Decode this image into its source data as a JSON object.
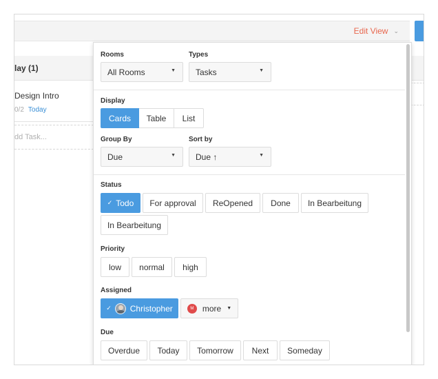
{
  "header": {
    "edit_view_label": "Edit View",
    "edit_view_icon": "chevron-down-icon"
  },
  "background_list": {
    "group_title": "lay (1)",
    "task": {
      "title": "Design Intro",
      "subtasks": "0/2",
      "due": "Today"
    },
    "add_task_placeholder": "dd Task..."
  },
  "filters": {
    "rooms": {
      "label": "Rooms",
      "value": "All Rooms"
    },
    "types": {
      "label": "Types",
      "value": "Tasks"
    },
    "display": {
      "label": "Display",
      "options": [
        "Cards",
        "Table",
        "List"
      ],
      "active": "Cards"
    },
    "group_by": {
      "label": "Group By",
      "value": "Due"
    },
    "sort_by": {
      "label": "Sort by",
      "value": "Due ↑"
    },
    "status": {
      "label": "Status",
      "options": [
        "Todo",
        "For approval",
        "ReOpened",
        "Done",
        "In Bearbeitung",
        "In Bearbeitung"
      ],
      "active": "Todo"
    },
    "priority": {
      "label": "Priority",
      "options": [
        "low",
        "normal",
        "high"
      ]
    },
    "assigned": {
      "label": "Assigned",
      "selected_user": "Christopher",
      "more_label": "more",
      "more_avatar_initial": "M"
    },
    "due": {
      "label": "Due",
      "options": [
        "Overdue",
        "Today",
        "Tomorrow",
        "Next",
        "Someday"
      ]
    }
  },
  "colors": {
    "accent": "#4a9be0",
    "edit_view": "#e8674e",
    "more_avatar": "#e04b4b",
    "link": "#3a8fd6"
  }
}
